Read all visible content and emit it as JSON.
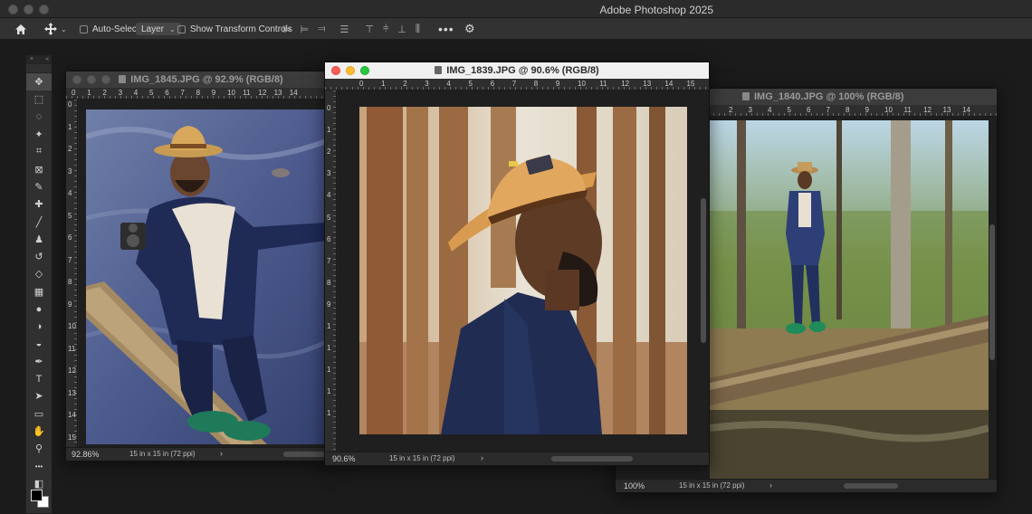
{
  "app": {
    "title": "Adobe Photoshop 2025"
  },
  "options_bar": {
    "auto_select_label": "Auto-Select:",
    "auto_select_target": "Layer",
    "show_transform_label": "Show Transform Controls",
    "more_label": "•••"
  },
  "tools_panel": {
    "close_label": "×",
    "collapse_label": "«",
    "tools": [
      {
        "name": "move-tool-icon",
        "glyph": "✥",
        "active": true
      },
      {
        "name": "marquee-tool-icon",
        "glyph": "⬚",
        "active": false
      },
      {
        "name": "lasso-tool-icon",
        "glyph": "◌",
        "active": false
      },
      {
        "name": "magic-wand-tool-icon",
        "glyph": "✦",
        "active": false
      },
      {
        "name": "crop-tool-icon",
        "glyph": "⌗",
        "active": false
      },
      {
        "name": "frame-tool-icon",
        "glyph": "⊠",
        "active": false
      },
      {
        "name": "eyedropper-tool-icon",
        "glyph": "✎",
        "active": false
      },
      {
        "name": "healing-brush-tool-icon",
        "glyph": "✚",
        "active": false
      },
      {
        "name": "brush-tool-icon",
        "glyph": "╱",
        "active": false
      },
      {
        "name": "clone-stamp-tool-icon",
        "glyph": "♟",
        "active": false
      },
      {
        "name": "history-brush-tool-icon",
        "glyph": "↺",
        "active": false
      },
      {
        "name": "eraser-tool-icon",
        "glyph": "◇",
        "active": false
      },
      {
        "name": "gradient-tool-icon",
        "glyph": "▦",
        "active": false
      },
      {
        "name": "blur-tool-icon",
        "glyph": "●",
        "active": false
      },
      {
        "name": "dodge-tool-icon",
        "glyph": "◑",
        "active": false
      },
      {
        "name": "burn-tool-icon",
        "glyph": "◒",
        "active": false
      },
      {
        "name": "pen-tool-icon",
        "glyph": "✒",
        "active": false
      },
      {
        "name": "type-tool-icon",
        "glyph": "T",
        "active": false
      },
      {
        "name": "path-selection-tool-icon",
        "glyph": "➤",
        "active": false
      },
      {
        "name": "rectangle-tool-icon",
        "glyph": "▭",
        "active": false
      },
      {
        "name": "hand-tool-icon",
        "glyph": "✋",
        "active": false
      },
      {
        "name": "zoom-tool-icon",
        "glyph": "⚲",
        "active": false
      },
      {
        "name": "more-tools-icon",
        "glyph": "•••",
        "active": false
      },
      {
        "name": "quick-mask-icon",
        "glyph": "◧",
        "active": false
      }
    ]
  },
  "documents": [
    {
      "id": "doc1",
      "title": "IMG_1845.JPG @ 92.9% (RGB/8)",
      "zoom": "92.86%",
      "size_info": "15 in x 15 in (72 ppi)",
      "active": false,
      "ruler_h": [
        "0",
        "1",
        "2",
        "3",
        "4",
        "5",
        "6",
        "7",
        "8",
        "9",
        "10",
        "11",
        "12",
        "13",
        "14"
      ],
      "ruler_v": [
        "0",
        "1",
        "2",
        "3",
        "4",
        "5",
        "6",
        "7",
        "8",
        "9",
        "10",
        "11",
        "12",
        "13",
        "14",
        "15"
      ]
    },
    {
      "id": "doc2",
      "title": "IMG_1839.JPG @ 90.6% (RGB/8)",
      "zoom": "90.6%",
      "size_info": "15 in x 15 in (72 ppi)",
      "active": true,
      "ruler_h": [
        "0",
        "1",
        "2",
        "3",
        "4",
        "5",
        "6",
        "7",
        "8",
        "9",
        "10",
        "11",
        "12",
        "13",
        "14",
        "15"
      ],
      "ruler_v": [
        "0",
        "1",
        "2",
        "3",
        "4",
        "5",
        "6",
        "7",
        "8",
        "9",
        "1",
        "1",
        "1",
        "1",
        "1"
      ]
    },
    {
      "id": "doc3",
      "title": "IMG_1840.JPG @ 100% (RGB/8)",
      "zoom": "100%",
      "size_info": "15 in x 15 in (72 ppi)",
      "active": false,
      "ruler_h": [
        "2",
        "3",
        "4",
        "5",
        "6",
        "7",
        "8",
        "9",
        "10",
        "11",
        "12",
        "13",
        "14"
      ],
      "ruler_v": []
    }
  ]
}
